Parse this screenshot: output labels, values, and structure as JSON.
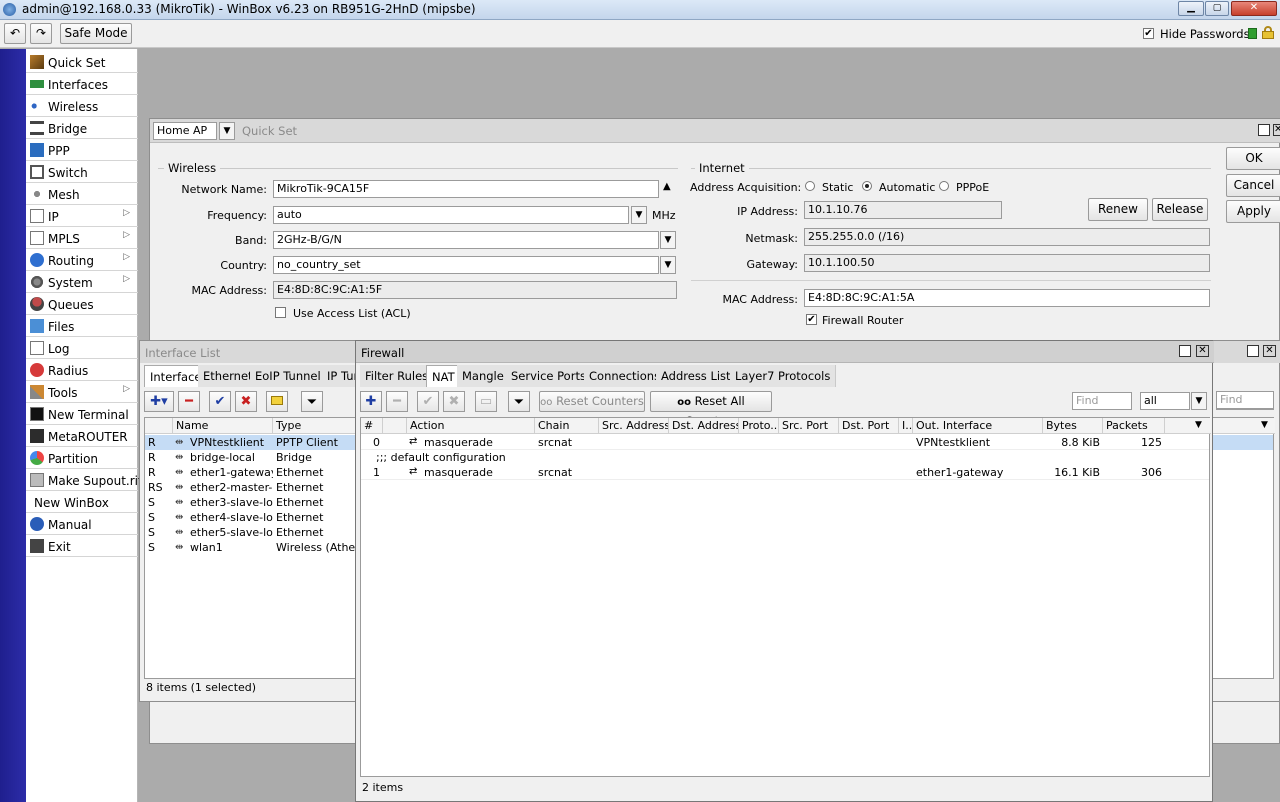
{
  "titlebar": {
    "text": "admin@192.168.0.33 (MikroTik) - WinBox v6.23 on RB951G-2HnD (mipsbe)"
  },
  "toolbar": {
    "safe_mode": "Safe Mode",
    "hide_passwords": "Hide Passwords"
  },
  "menu": [
    {
      "label": "Quick Set",
      "icon": "quick-set-icon",
      "sub": false
    },
    {
      "label": "Interfaces",
      "icon": "interfaces-icon",
      "sub": false
    },
    {
      "label": "Wireless",
      "icon": "wireless-icon",
      "sub": false
    },
    {
      "label": "Bridge",
      "icon": "bridge-icon",
      "sub": false
    },
    {
      "label": "PPP",
      "icon": "ppp-icon",
      "sub": false
    },
    {
      "label": "Switch",
      "icon": "switch-icon",
      "sub": false
    },
    {
      "label": "Mesh",
      "icon": "mesh-icon",
      "sub": false
    },
    {
      "label": "IP",
      "icon": "ip-icon",
      "sub": true
    },
    {
      "label": "MPLS",
      "icon": "mpls-icon",
      "sub": true
    },
    {
      "label": "Routing",
      "icon": "routing-icon",
      "sub": true
    },
    {
      "label": "System",
      "icon": "system-icon",
      "sub": true
    },
    {
      "label": "Queues",
      "icon": "queues-icon",
      "sub": false
    },
    {
      "label": "Files",
      "icon": "files-icon",
      "sub": false
    },
    {
      "label": "Log",
      "icon": "log-icon",
      "sub": false
    },
    {
      "label": "Radius",
      "icon": "radius-icon",
      "sub": false
    },
    {
      "label": "Tools",
      "icon": "tools-icon",
      "sub": true
    },
    {
      "label": "New Terminal",
      "icon": "terminal-icon",
      "sub": false
    },
    {
      "label": "MetaROUTER",
      "icon": "metarouter-icon",
      "sub": false
    },
    {
      "label": "Partition",
      "icon": "partition-icon",
      "sub": false
    },
    {
      "label": "Make Supout.rif",
      "icon": "supout-icon",
      "sub": false
    },
    {
      "label": "New WinBox",
      "icon": "",
      "sub": false
    },
    {
      "label": "Manual",
      "icon": "manual-icon",
      "sub": false
    },
    {
      "label": "Exit",
      "icon": "exit-icon",
      "sub": false
    }
  ],
  "quickset": {
    "mode": "Home AP",
    "title": "Quick Set",
    "wireless_legend": "Wireless",
    "internet_legend": "Internet",
    "network_name_label": "Network Name:",
    "network_name": "MikroTik-9CA15F",
    "frequency_label": "Frequency:",
    "frequency": "auto",
    "frequency_unit": "MHz",
    "band_label": "Band:",
    "band": "2GHz-B/G/N",
    "country_label": "Country:",
    "country": "no_country_set",
    "mac_label": "MAC Address:",
    "mac": "E4:8D:8C:9C:A1:5F",
    "acl_label": "Use Access List (ACL)",
    "addr_acq_label": "Address Acquisition:",
    "static": "Static",
    "automatic": "Automatic",
    "pppoe": "PPPoE",
    "ip_label": "IP Address:",
    "ip": "10.1.10.76",
    "netmask_label": "Netmask:",
    "netmask": "255.255.0.0 (/16)",
    "gateway_label": "Gateway:",
    "gateway": "10.1.100.50",
    "inet_mac_label": "MAC Address:",
    "inet_mac": "E4:8D:8C:9C:A1:5A",
    "firewall_router": "Firewall Router",
    "renew": "Renew",
    "release": "Release",
    "ok": "OK",
    "cancel": "Cancel",
    "apply": "Apply"
  },
  "iflist": {
    "title": "Interface List",
    "tabs": [
      "Interface",
      "Ethernet",
      "EoIP Tunnel",
      "IP Tun"
    ],
    "col_name": "Name",
    "col_type": "Type",
    "rows": [
      {
        "flag": "R",
        "name": "VPNtestklient",
        "type": "PPTP Client"
      },
      {
        "flag": "R",
        "name": "bridge-local",
        "type": "Bridge"
      },
      {
        "flag": "R",
        "name": "ether1-gateway",
        "type": "Ethernet"
      },
      {
        "flag": "RS",
        "name": "ether2-master-l...",
        "type": "Ethernet"
      },
      {
        "flag": "S",
        "name": "ether3-slave-lo...",
        "type": "Ethernet"
      },
      {
        "flag": "S",
        "name": "ether4-slave-lo...",
        "type": "Ethernet"
      },
      {
        "flag": "S",
        "name": "ether5-slave-lo...",
        "type": "Ethernet"
      },
      {
        "flag": "S",
        "name": "wlan1",
        "type": "Wireless (Atheros"
      }
    ],
    "status": "8 items (1 selected)",
    "find_placeholder": "Find"
  },
  "firewall": {
    "title": "Firewall",
    "tabs": [
      "Filter Rules",
      "NAT",
      "Mangle",
      "Service Ports",
      "Connections",
      "Address Lists",
      "Layer7 Protocols"
    ],
    "reset_counters": "Reset Counters",
    "reset_all_counters": "Reset All Counters",
    "find_placeholder": "Find",
    "filter_value": "all",
    "columns": [
      "#",
      "",
      "Action",
      "Chain",
      "Src. Address",
      "Dst. Address",
      "Proto...",
      "Src. Port",
      "Dst. Port",
      "I...",
      "Out. Interface",
      "Bytes",
      "Packets"
    ],
    "rows": [
      {
        "num": "0",
        "action": "masquerade",
        "chain": "srcnat",
        "out_if": "VPNtestklient",
        "bytes": "8.8 KiB",
        "packets": "125"
      },
      {
        "comment": ";;; default configuration"
      },
      {
        "num": "1",
        "action": "masquerade",
        "chain": "srcnat",
        "out_if": "ether1-gateway",
        "bytes": "16.1 KiB",
        "packets": "306"
      }
    ],
    "status": "2 items"
  }
}
